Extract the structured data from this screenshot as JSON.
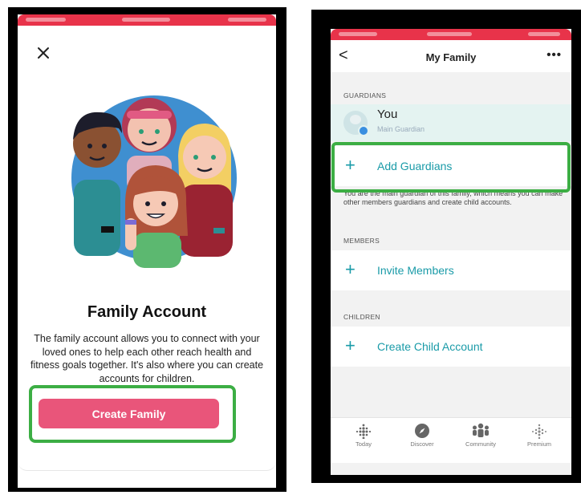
{
  "left": {
    "title": "Family Account",
    "description": "The family account allows you to connect with your loved ones to help each other reach health and fitness goals together. It's also where you can create accounts for children.",
    "cta_label": "Create Family",
    "close_icon": "close-icon"
  },
  "right": {
    "nav": {
      "back_icon": "<",
      "title": "My Family",
      "more_icon": "•••"
    },
    "guardians_header": "GUARDIANS",
    "you": {
      "name": "You",
      "role": "Main Guardian"
    },
    "add_guardians": "Add Guardians",
    "guardian_note": "You are the main guardian of this family, which means you can make other members guardians and create child accounts.",
    "members_header": "MEMBERS",
    "invite_members": "Invite Members",
    "children_header": "CHILDREN",
    "create_child": "Create Child Account",
    "plus": "+",
    "tabs": [
      {
        "label": "Today",
        "icon": "today-icon"
      },
      {
        "label": "Discover",
        "icon": "discover-icon"
      },
      {
        "label": "Community",
        "icon": "community-icon"
      },
      {
        "label": "Premium",
        "icon": "premium-icon"
      }
    ]
  },
  "colors": {
    "status_bar": "#e8334a",
    "cta": "#e9557a",
    "highlight": "#3cae44",
    "teal": "#1a9ba8"
  }
}
